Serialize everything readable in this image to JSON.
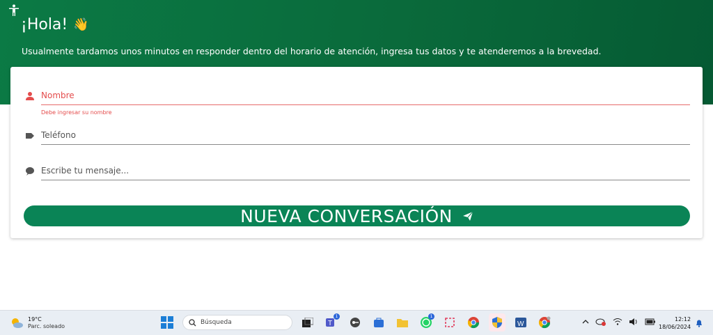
{
  "header": {
    "title": "¡Hola!",
    "wave_emoji": "👋",
    "subtitle": "Usualmente tardamos unos minutos en responder dentro del horario de atención, ingresa tus datos y te atenderemos a la brevedad."
  },
  "form": {
    "name_placeholder": "Nombre",
    "name_error": "Debe ingresar su nombre",
    "phone_placeholder": "Teléfono",
    "message_placeholder": "Escribe tu mensaje...",
    "submit_label": "NUEVA CONVERSACIÓN"
  },
  "taskbar": {
    "temperature": "19°C",
    "weather_text": "Parc. soleado",
    "search_placeholder": "Búsqueda",
    "teams_badge": "1",
    "whatsapp_badge": "1",
    "time": "12:12",
    "date": "18/06/2024"
  },
  "colors": {
    "header_bg": "#0a6a3b",
    "button_bg": "#0a8456",
    "error": "#e44c4c"
  }
}
